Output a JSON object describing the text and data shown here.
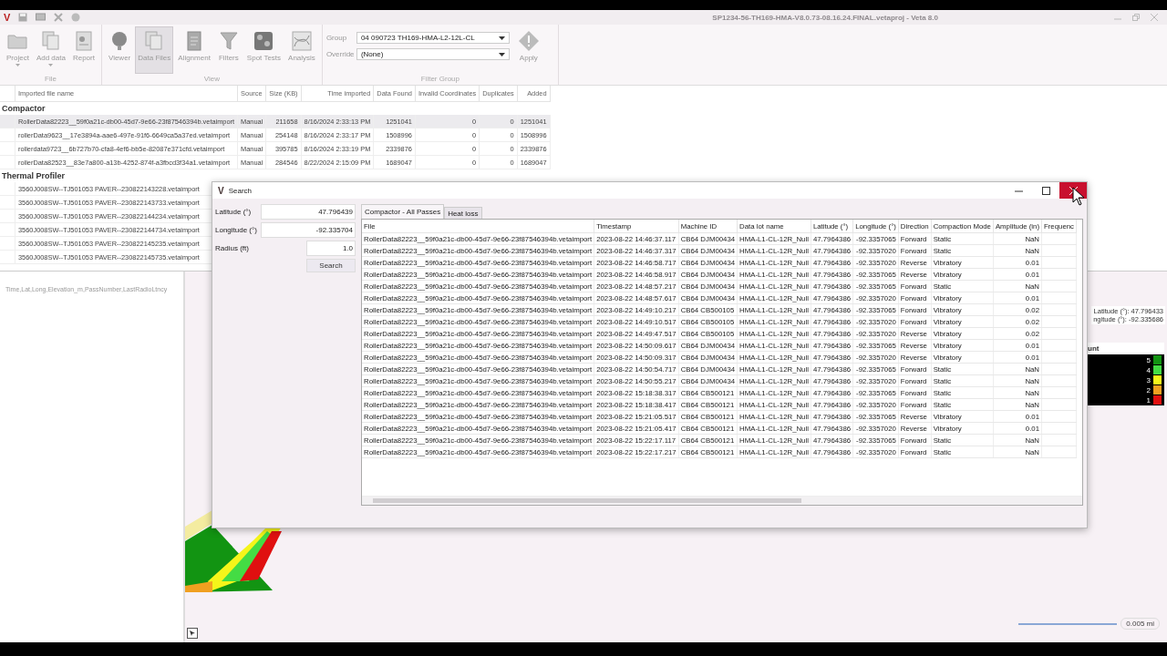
{
  "window": {
    "title": "SP1234-56-TH169-HMA-V8.0.73-08.16.24.FINAL.vetaproj - Veta 8.0",
    "logo": "V"
  },
  "ribbon": {
    "groups": [
      {
        "label": "File",
        "buttons": [
          {
            "label": "Project",
            "selected": false,
            "dropdown": true
          },
          {
            "label": "Add data",
            "selected": false,
            "dropdown": true
          },
          {
            "label": "Report",
            "selected": false,
            "dropdown": false
          }
        ]
      },
      {
        "label": "View",
        "buttons": [
          {
            "label": "Viewer",
            "selected": false,
            "dropdown": false
          },
          {
            "label": "Data Files",
            "selected": true,
            "dropdown": false
          },
          {
            "label": "Alignment",
            "selected": false,
            "dropdown": false
          },
          {
            "label": "Filters",
            "selected": false,
            "dropdown": false
          },
          {
            "label": "Spot Tests",
            "selected": false,
            "dropdown": false
          },
          {
            "label": "Analysis",
            "selected": false,
            "dropdown": false
          }
        ]
      }
    ],
    "filter_group": {
      "label": "Filter Group",
      "group_label": "Group",
      "group_value": "04 090723 TH169-HMA-L2-12L-CL",
      "override_label": "Override",
      "override_value": "(None)",
      "apply": "Apply"
    }
  },
  "files_table": {
    "columns": [
      "Imported file name",
      "Source",
      "Size (KB)",
      "Time imported",
      "Data Found",
      "Invalid Coordinates",
      "Duplicates",
      "Added"
    ],
    "groups": [
      {
        "name": "Compactor",
        "rows": [
          {
            "selected": true,
            "cells": [
              "RollerData82223__59f0a21c-db00-45d7-9e66-23f87546394b.vetaimport",
              "Manual",
              "211658",
              "8/16/2024 2:33:13 PM",
              "1251041",
              "0",
              "0",
              "1251041"
            ]
          },
          {
            "selected": false,
            "cells": [
              "rollerData9623__17e3894a-aae6-497e-91f6-6649ca5a37ed.vetaimport",
              "Manual",
              "254148",
              "8/16/2024 2:33:17 PM",
              "1508996",
              "0",
              "0",
              "1508996"
            ]
          },
          {
            "selected": false,
            "cells": [
              "rollerdata9723__6b727b70-cfa8-4ef6-bb5e-82087e371cfd.vetaimport",
              "Manual",
              "395785",
              "8/16/2024 2:33:19 PM",
              "2339876",
              "0",
              "0",
              "2339876"
            ]
          },
          {
            "selected": false,
            "cells": [
              "rollerData82523__83e7a800-a13b-4252-874f-a3fbcd3f34a1.vetaimport",
              "Manual",
              "284546",
              "8/22/2024 2:15:09 PM",
              "1689047",
              "0",
              "0",
              "1689047"
            ]
          }
        ]
      },
      {
        "name": "Thermal Profiler",
        "rows": [
          {
            "selected": false,
            "cells": [
              "3560J008SW--TJ501053 PAVER--230822143228.vetaimport"
            ]
          },
          {
            "selected": false,
            "cells": [
              "3560J008SW--TJ501053 PAVER--230822143733.vetaimport"
            ]
          },
          {
            "selected": false,
            "cells": [
              "3560J008SW--TJ501053 PAVER--230822144234.vetaimport"
            ]
          },
          {
            "selected": false,
            "cells": [
              "3560J008SW--TJ501053 PAVER--230822144734.vetaimport"
            ]
          },
          {
            "selected": false,
            "cells": [
              "3560J008SW--TJ501053 PAVER--230822145235.vetaimport"
            ]
          },
          {
            "selected": false,
            "cells": [
              "3560J008SW--TJ501053 PAVER--230822145735.vetaimport"
            ]
          }
        ]
      }
    ]
  },
  "points_panel": {
    "header": "Time,Lat,Long,Elevation_m,PassNumber,LastRadioLtncy"
  },
  "map": {
    "latitude": "Latitude (°): 47.796433",
    "longitude": "ngitude (°): -92.335686",
    "legend_title": "unt",
    "legend": [
      {
        "label": "5",
        "color": "#129412"
      },
      {
        "label": "4",
        "color": "#44dc44"
      },
      {
        "label": "3",
        "color": "#f5f51a"
      },
      {
        "label": "2",
        "color": "#f0a020"
      },
      {
        "label": "1",
        "color": "#e01010"
      }
    ],
    "scale": "0.005 mi"
  },
  "search_dialog": {
    "title": "Search",
    "logo": "V",
    "fields": [
      {
        "label": "Latitude (°)",
        "value": "47.796439"
      },
      {
        "label": "Longitude (°)",
        "value": "-92.335704"
      },
      {
        "label": "Radius (ft)",
        "value": "1.0"
      }
    ],
    "search_button": "Search",
    "tabs": [
      {
        "label": "Compactor - All Passes",
        "selected": true
      },
      {
        "label": "Heat loss",
        "selected": false
      }
    ],
    "columns": [
      "File",
      "Timestamp",
      "Machine ID",
      "Data lot name",
      "Latitude (°)",
      "Longitude (°)",
      "Direction",
      "Compaction Mode",
      "Amplitude (in)",
      "Frequenc"
    ],
    "rows": [
      [
        "RollerData82223__59f0a21c-db00-45d7-9e66-23f87546394b.vetaimport",
        "2023-08-22 14:46:37.117",
        "CB64 DJM00434",
        "HMA-L1-CL-12R_Null",
        "47.7964386",
        "-92.3357065",
        "Forward",
        "Static",
        "NaN"
      ],
      [
        "RollerData82223__59f0a21c-db00-45d7-9e66-23f87546394b.vetaimport",
        "2023-08-22 14:46:37.317",
        "CB64 DJM00434",
        "HMA-L1-CL-12R_Null",
        "47.7964386",
        "-92.3357020",
        "Forward",
        "Static",
        "NaN"
      ],
      [
        "RollerData82223__59f0a21c-db00-45d7-9e66-23f87546394b.vetaimport",
        "2023-08-22 14:46:58.717",
        "CB64 DJM00434",
        "HMA-L1-CL-12R_Null",
        "47.7964386",
        "-92.3357020",
        "Reverse",
        "Vibratory",
        "0.01"
      ],
      [
        "RollerData82223__59f0a21c-db00-45d7-9e66-23f87546394b.vetaimport",
        "2023-08-22 14:46:58.917",
        "CB64 DJM00434",
        "HMA-L1-CL-12R_Null",
        "47.7964386",
        "-92.3357065",
        "Reverse",
        "Vibratory",
        "0.01"
      ],
      [
        "RollerData82223__59f0a21c-db00-45d7-9e66-23f87546394b.vetaimport",
        "2023-08-22 14:48:57.217",
        "CB64 DJM00434",
        "HMA-L1-CL-12R_Null",
        "47.7964386",
        "-92.3357065",
        "Forward",
        "Static",
        "NaN"
      ],
      [
        "RollerData82223__59f0a21c-db00-45d7-9e66-23f87546394b.vetaimport",
        "2023-08-22 14:48:57.617",
        "CB64 DJM00434",
        "HMA-L1-CL-12R_Null",
        "47.7964386",
        "-92.3357020",
        "Forward",
        "Vibratory",
        "0.01"
      ],
      [
        "RollerData82223__59f0a21c-db00-45d7-9e66-23f87546394b.vetaimport",
        "2023-08-22 14:49:10.217",
        "CB64 CB500105",
        "HMA-L1-CL-12R_Null",
        "47.7964386",
        "-92.3357065",
        "Forward",
        "Vibratory",
        "0.02"
      ],
      [
        "RollerData82223__59f0a21c-db00-45d7-9e66-23f87546394b.vetaimport",
        "2023-08-22 14:49:10.517",
        "CB64 CB500105",
        "HMA-L1-CL-12R_Null",
        "47.7964386",
        "-92.3357020",
        "Forward",
        "Vibratory",
        "0.02"
      ],
      [
        "RollerData82223__59f0a21c-db00-45d7-9e66-23f87546394b.vetaimport",
        "2023-08-22 14:49:47.517",
        "CB64 CB500105",
        "HMA-L1-CL-12R_Null",
        "47.7964386",
        "-92.3357020",
        "Reverse",
        "Vibratory",
        "0.02"
      ],
      [
        "RollerData82223__59f0a21c-db00-45d7-9e66-23f87546394b.vetaimport",
        "2023-08-22 14:50:09.617",
        "CB64 DJM00434",
        "HMA-L1-CL-12R_Null",
        "47.7964386",
        "-92.3357065",
        "Reverse",
        "Vibratory",
        "0.01"
      ],
      [
        "RollerData82223__59f0a21c-db00-45d7-9e66-23f87546394b.vetaimport",
        "2023-08-22 14:50:09.317",
        "CB64 DJM00434",
        "HMA-L1-CL-12R_Null",
        "47.7964386",
        "-92.3357020",
        "Reverse",
        "Vibratory",
        "0.01"
      ],
      [
        "RollerData82223__59f0a21c-db00-45d7-9e66-23f87546394b.vetaimport",
        "2023-08-22 14:50:54.717",
        "CB64 DJM00434",
        "HMA-L1-CL-12R_Null",
        "47.7964386",
        "-92.3357065",
        "Forward",
        "Static",
        "NaN"
      ],
      [
        "RollerData82223__59f0a21c-db00-45d7-9e66-23f87546394b.vetaimport",
        "2023-08-22 14:50:55.217",
        "CB64 DJM00434",
        "HMA-L1-CL-12R_Null",
        "47.7964386",
        "-92.3357020",
        "Forward",
        "Static",
        "NaN"
      ],
      [
        "RollerData82223__59f0a21c-db00-45d7-9e66-23f87546394b.vetaimport",
        "2023-08-22 15:18:38.317",
        "CB64 CB500121",
        "HMA-L1-CL-12R_Null",
        "47.7964386",
        "-92.3357065",
        "Forward",
        "Static",
        "NaN"
      ],
      [
        "RollerData82223__59f0a21c-db00-45d7-9e66-23f87546394b.vetaimport",
        "2023-08-22 15:18:38.417",
        "CB64 CB500121",
        "HMA-L1-CL-12R_Null",
        "47.7964386",
        "-92.3357020",
        "Forward",
        "Static",
        "NaN"
      ],
      [
        "RollerData82223__59f0a21c-db00-45d7-9e66-23f87546394b.vetaimport",
        "2023-08-22 15:21:05.517",
        "CB64 CB500121",
        "HMA-L1-CL-12R_Null",
        "47.7964386",
        "-92.3357065",
        "Reverse",
        "Vibratory",
        "0.01"
      ],
      [
        "RollerData82223__59f0a21c-db00-45d7-9e66-23f87546394b.vetaimport",
        "2023-08-22 15:21:05.417",
        "CB64 CB500121",
        "HMA-L1-CL-12R_Null",
        "47.7964386",
        "-92.3357020",
        "Reverse",
        "Vibratory",
        "0.01"
      ],
      [
        "RollerData82223__59f0a21c-db00-45d7-9e66-23f87546394b.vetaimport",
        "2023-08-22 15:22:17.117",
        "CB64 CB500121",
        "HMA-L1-CL-12R_Null",
        "47.7964386",
        "-92.3357065",
        "Forward",
        "Static",
        "NaN"
      ],
      [
        "RollerData82223__59f0a21c-db00-45d7-9e66-23f87546394b.vetaimport",
        "2023-08-22 15:22:17.217",
        "CB64 CB500121",
        "HMA-L1-CL-12R_Null",
        "47.7964386",
        "-92.3357020",
        "Forward",
        "Static",
        "NaN"
      ]
    ]
  }
}
